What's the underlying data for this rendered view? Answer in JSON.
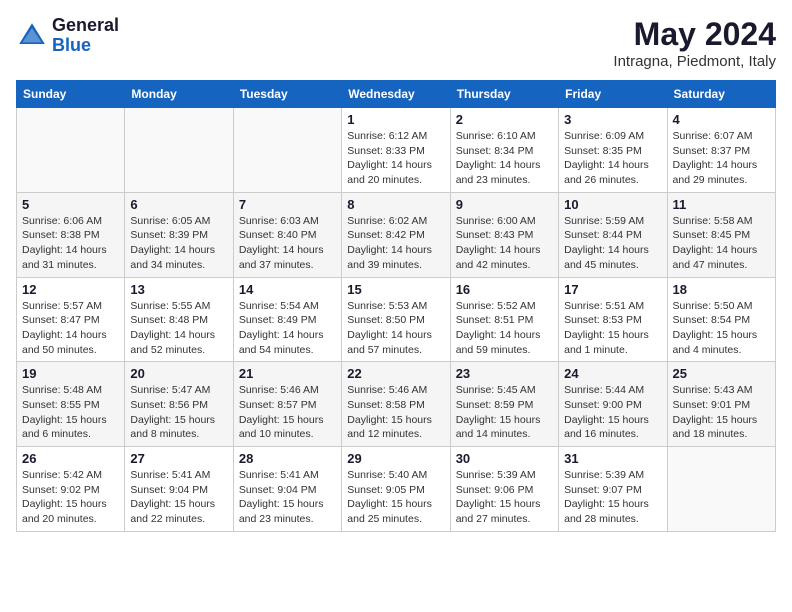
{
  "header": {
    "logo_general": "General",
    "logo_blue": "Blue",
    "title": "May 2024",
    "subtitle": "Intragna, Piedmont, Italy"
  },
  "calendar": {
    "days_of_week": [
      "Sunday",
      "Monday",
      "Tuesday",
      "Wednesday",
      "Thursday",
      "Friday",
      "Saturday"
    ],
    "weeks": [
      [
        {
          "day": "",
          "info": ""
        },
        {
          "day": "",
          "info": ""
        },
        {
          "day": "",
          "info": ""
        },
        {
          "day": "1",
          "info": "Sunrise: 6:12 AM\nSunset: 8:33 PM\nDaylight: 14 hours\nand 20 minutes."
        },
        {
          "day": "2",
          "info": "Sunrise: 6:10 AM\nSunset: 8:34 PM\nDaylight: 14 hours\nand 23 minutes."
        },
        {
          "day": "3",
          "info": "Sunrise: 6:09 AM\nSunset: 8:35 PM\nDaylight: 14 hours\nand 26 minutes."
        },
        {
          "day": "4",
          "info": "Sunrise: 6:07 AM\nSunset: 8:37 PM\nDaylight: 14 hours\nand 29 minutes."
        }
      ],
      [
        {
          "day": "5",
          "info": "Sunrise: 6:06 AM\nSunset: 8:38 PM\nDaylight: 14 hours\nand 31 minutes."
        },
        {
          "day": "6",
          "info": "Sunrise: 6:05 AM\nSunset: 8:39 PM\nDaylight: 14 hours\nand 34 minutes."
        },
        {
          "day": "7",
          "info": "Sunrise: 6:03 AM\nSunset: 8:40 PM\nDaylight: 14 hours\nand 37 minutes."
        },
        {
          "day": "8",
          "info": "Sunrise: 6:02 AM\nSunset: 8:42 PM\nDaylight: 14 hours\nand 39 minutes."
        },
        {
          "day": "9",
          "info": "Sunrise: 6:00 AM\nSunset: 8:43 PM\nDaylight: 14 hours\nand 42 minutes."
        },
        {
          "day": "10",
          "info": "Sunrise: 5:59 AM\nSunset: 8:44 PM\nDaylight: 14 hours\nand 45 minutes."
        },
        {
          "day": "11",
          "info": "Sunrise: 5:58 AM\nSunset: 8:45 PM\nDaylight: 14 hours\nand 47 minutes."
        }
      ],
      [
        {
          "day": "12",
          "info": "Sunrise: 5:57 AM\nSunset: 8:47 PM\nDaylight: 14 hours\nand 50 minutes."
        },
        {
          "day": "13",
          "info": "Sunrise: 5:55 AM\nSunset: 8:48 PM\nDaylight: 14 hours\nand 52 minutes."
        },
        {
          "day": "14",
          "info": "Sunrise: 5:54 AM\nSunset: 8:49 PM\nDaylight: 14 hours\nand 54 minutes."
        },
        {
          "day": "15",
          "info": "Sunrise: 5:53 AM\nSunset: 8:50 PM\nDaylight: 14 hours\nand 57 minutes."
        },
        {
          "day": "16",
          "info": "Sunrise: 5:52 AM\nSunset: 8:51 PM\nDaylight: 14 hours\nand 59 minutes."
        },
        {
          "day": "17",
          "info": "Sunrise: 5:51 AM\nSunset: 8:53 PM\nDaylight: 15 hours\nand 1 minute."
        },
        {
          "day": "18",
          "info": "Sunrise: 5:50 AM\nSunset: 8:54 PM\nDaylight: 15 hours\nand 4 minutes."
        }
      ],
      [
        {
          "day": "19",
          "info": "Sunrise: 5:48 AM\nSunset: 8:55 PM\nDaylight: 15 hours\nand 6 minutes."
        },
        {
          "day": "20",
          "info": "Sunrise: 5:47 AM\nSunset: 8:56 PM\nDaylight: 15 hours\nand 8 minutes."
        },
        {
          "day": "21",
          "info": "Sunrise: 5:46 AM\nSunset: 8:57 PM\nDaylight: 15 hours\nand 10 minutes."
        },
        {
          "day": "22",
          "info": "Sunrise: 5:46 AM\nSunset: 8:58 PM\nDaylight: 15 hours\nand 12 minutes."
        },
        {
          "day": "23",
          "info": "Sunrise: 5:45 AM\nSunset: 8:59 PM\nDaylight: 15 hours\nand 14 minutes."
        },
        {
          "day": "24",
          "info": "Sunrise: 5:44 AM\nSunset: 9:00 PM\nDaylight: 15 hours\nand 16 minutes."
        },
        {
          "day": "25",
          "info": "Sunrise: 5:43 AM\nSunset: 9:01 PM\nDaylight: 15 hours\nand 18 minutes."
        }
      ],
      [
        {
          "day": "26",
          "info": "Sunrise: 5:42 AM\nSunset: 9:02 PM\nDaylight: 15 hours\nand 20 minutes."
        },
        {
          "day": "27",
          "info": "Sunrise: 5:41 AM\nSunset: 9:04 PM\nDaylight: 15 hours\nand 22 minutes."
        },
        {
          "day": "28",
          "info": "Sunrise: 5:41 AM\nSunset: 9:04 PM\nDaylight: 15 hours\nand 23 minutes."
        },
        {
          "day": "29",
          "info": "Sunrise: 5:40 AM\nSunset: 9:05 PM\nDaylight: 15 hours\nand 25 minutes."
        },
        {
          "day": "30",
          "info": "Sunrise: 5:39 AM\nSunset: 9:06 PM\nDaylight: 15 hours\nand 27 minutes."
        },
        {
          "day": "31",
          "info": "Sunrise: 5:39 AM\nSunset: 9:07 PM\nDaylight: 15 hours\nand 28 minutes."
        },
        {
          "day": "",
          "info": ""
        }
      ]
    ]
  }
}
